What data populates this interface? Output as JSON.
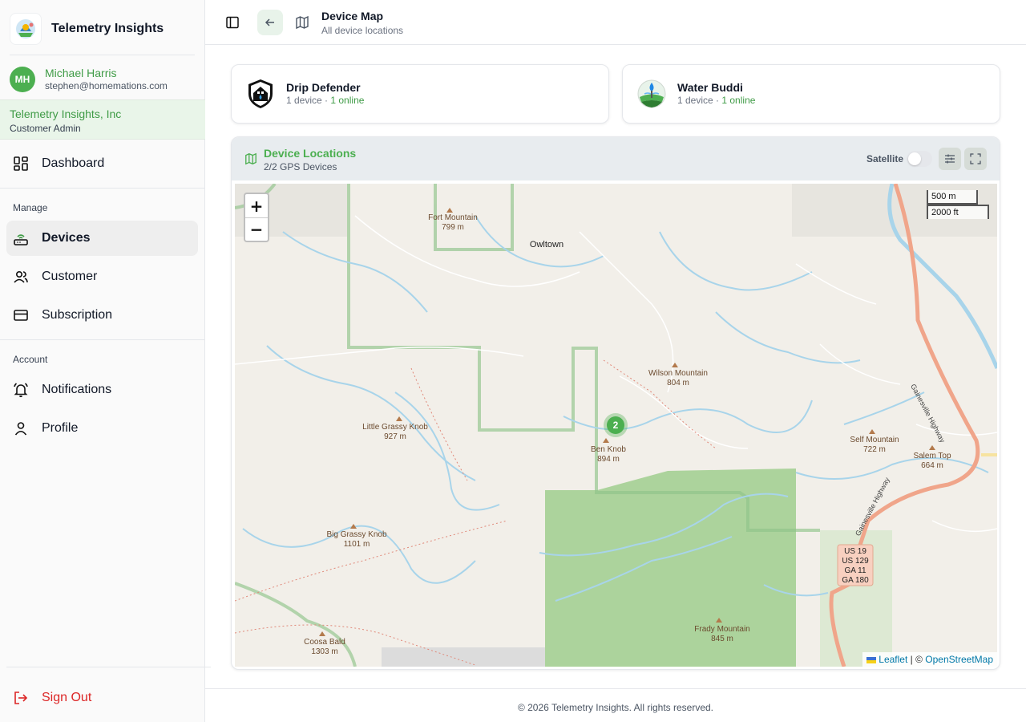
{
  "app": {
    "title": "Telemetry Insights"
  },
  "user": {
    "initials": "MH",
    "name": "Michael Harris",
    "email": "stephen@homemations.com"
  },
  "org": {
    "name": "Telemetry Insights, Inc",
    "role": "Customer Admin"
  },
  "nav": {
    "dashboard": "Dashboard",
    "manage_label": "Manage",
    "devices": "Devices",
    "customer": "Customer",
    "subscription": "Subscription",
    "account_label": "Account",
    "notifications": "Notifications",
    "profile": "Profile",
    "sign_out": "Sign Out",
    "active": "Devices"
  },
  "header": {
    "title": "Device Map",
    "subtitle": "All device locations"
  },
  "devices": [
    {
      "name": "Drip Defender",
      "count": "1 device",
      "separator": " · ",
      "online": "1 online"
    },
    {
      "name": "Water Buddi",
      "count": "1 device",
      "separator": " · ",
      "online": "1 online"
    }
  ],
  "map_panel": {
    "title": "Device Locations",
    "subtitle": "2/2 GPS Devices",
    "satellite_label": "Satellite",
    "satellite_on": false,
    "zoom_in": "+",
    "zoom_out": "−",
    "scale_metric": "500 m",
    "scale_imperial": "2000 ft",
    "cluster_count": "2",
    "attribution": {
      "leaflet": "Leaflet",
      "separator": " | © ",
      "osm": "OpenStreetMap"
    },
    "places": [
      {
        "name": "Fort Mountain",
        "elev": "799 m"
      },
      {
        "name": "Owltown",
        "elev": ""
      },
      {
        "name": "Wilson Mountain",
        "elev": "804 m"
      },
      {
        "name": "Little Grassy Knob",
        "elev": "927 m"
      },
      {
        "name": "Ben Knob",
        "elev": "894 m"
      },
      {
        "name": "Self Mountain",
        "elev": "722 m"
      },
      {
        "name": "Salem Top",
        "elev": "664 m"
      },
      {
        "name": "Big Grassy Knob",
        "elev": "1101 m"
      },
      {
        "name": "Coosa Bald",
        "elev": "1303 m"
      },
      {
        "name": "Frady Mountain",
        "elev": "845 m"
      }
    ],
    "road_label": "Gainesville Highway",
    "shield_lines": [
      "US 19",
      "US 129",
      "GA 11",
      "GA 180"
    ],
    "colors": {
      "forest": "#a9d19b",
      "water": "#a8d4ea",
      "road": "#f0a58a",
      "boundary": "#8fc38a"
    }
  },
  "footer": {
    "text": "© 2026 Telemetry Insights. All rights reserved."
  }
}
